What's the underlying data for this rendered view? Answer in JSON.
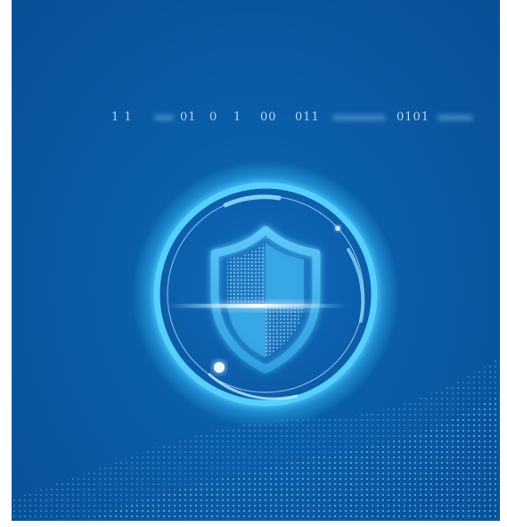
{
  "binary_text": {
    "seg1": "1 1",
    "seg2": "01",
    "seg3": "0",
    "seg4": "1",
    "seg5": "00",
    "seg6": "011",
    "seg7": "0101"
  },
  "colors": {
    "background": "#0a5ca6",
    "glow": "#39c4ff",
    "ring": "#7fd8ff",
    "shield": "#4ab8ee",
    "binary_text": "#b9d4ef"
  },
  "icons": {
    "shield": "shield-icon",
    "ring": "glowing-ring"
  }
}
